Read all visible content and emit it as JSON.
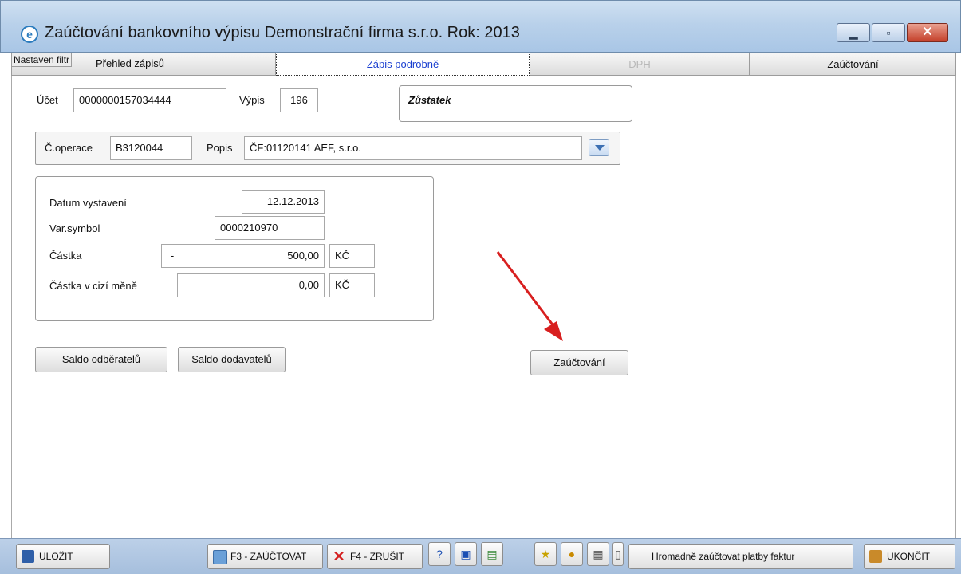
{
  "window": {
    "title": "Zaúčtování bankovního výpisu  Demonstrační firma s.r.o.  Rok: 2013",
    "app_icon_glyph": "e",
    "minimize_glyph": "▁",
    "maximize_glyph": "▫",
    "close_glyph": "✕"
  },
  "tabs": {
    "filter_tag": "Nastaven filtr",
    "items": [
      {
        "label": "Přehled zápisů",
        "state": "normal"
      },
      {
        "label": "Zápis podrobně",
        "state": "active"
      },
      {
        "label": "DPH",
        "state": "disabled"
      },
      {
        "label": "Zaúčtování",
        "state": "normal"
      }
    ]
  },
  "header": {
    "ucet_label": "Účet",
    "ucet_value": "0000000157034444",
    "vypis_label": "Výpis",
    "vypis_value": "196",
    "zustatek_label": "Zůstatek"
  },
  "operation": {
    "coperace_label": "Č.operace",
    "coperace_value": "B3120044",
    "popis_label": "Popis",
    "popis_value": "ČF:01120141 AEF, s.r.o."
  },
  "details": {
    "datum_label": "Datum vystavení",
    "datum_value": "12.12.2013",
    "varsymbol_label": "Var.symbol",
    "varsymbol_value": "0000210970",
    "castka_label": "Částka",
    "castka_sign": "-",
    "castka_value": "500,00",
    "castka_currency": "KČ",
    "castka_cizi_label": "Částka v cizí měně",
    "castka_cizi_value": "0,00",
    "castka_cizi_currency": "KČ"
  },
  "buttons": {
    "saldo_odberatelu": "Saldo odběratelů",
    "saldo_dodavatelu": "Saldo dodavatelů",
    "zauctovani": "Zaúčtování"
  },
  "toolbar": {
    "ulozit": "ULOŽIT",
    "f3": "F3 - ZAÚČTOVAT",
    "f4": "F4 - ZRUŠIT",
    "hromadne": "Hromadně zaúčtovat platby faktur",
    "ukoncit": "UKONČIT"
  },
  "colors": {
    "accent_blue": "#1a3fd0",
    "arrow_red": "#d81f1f"
  }
}
